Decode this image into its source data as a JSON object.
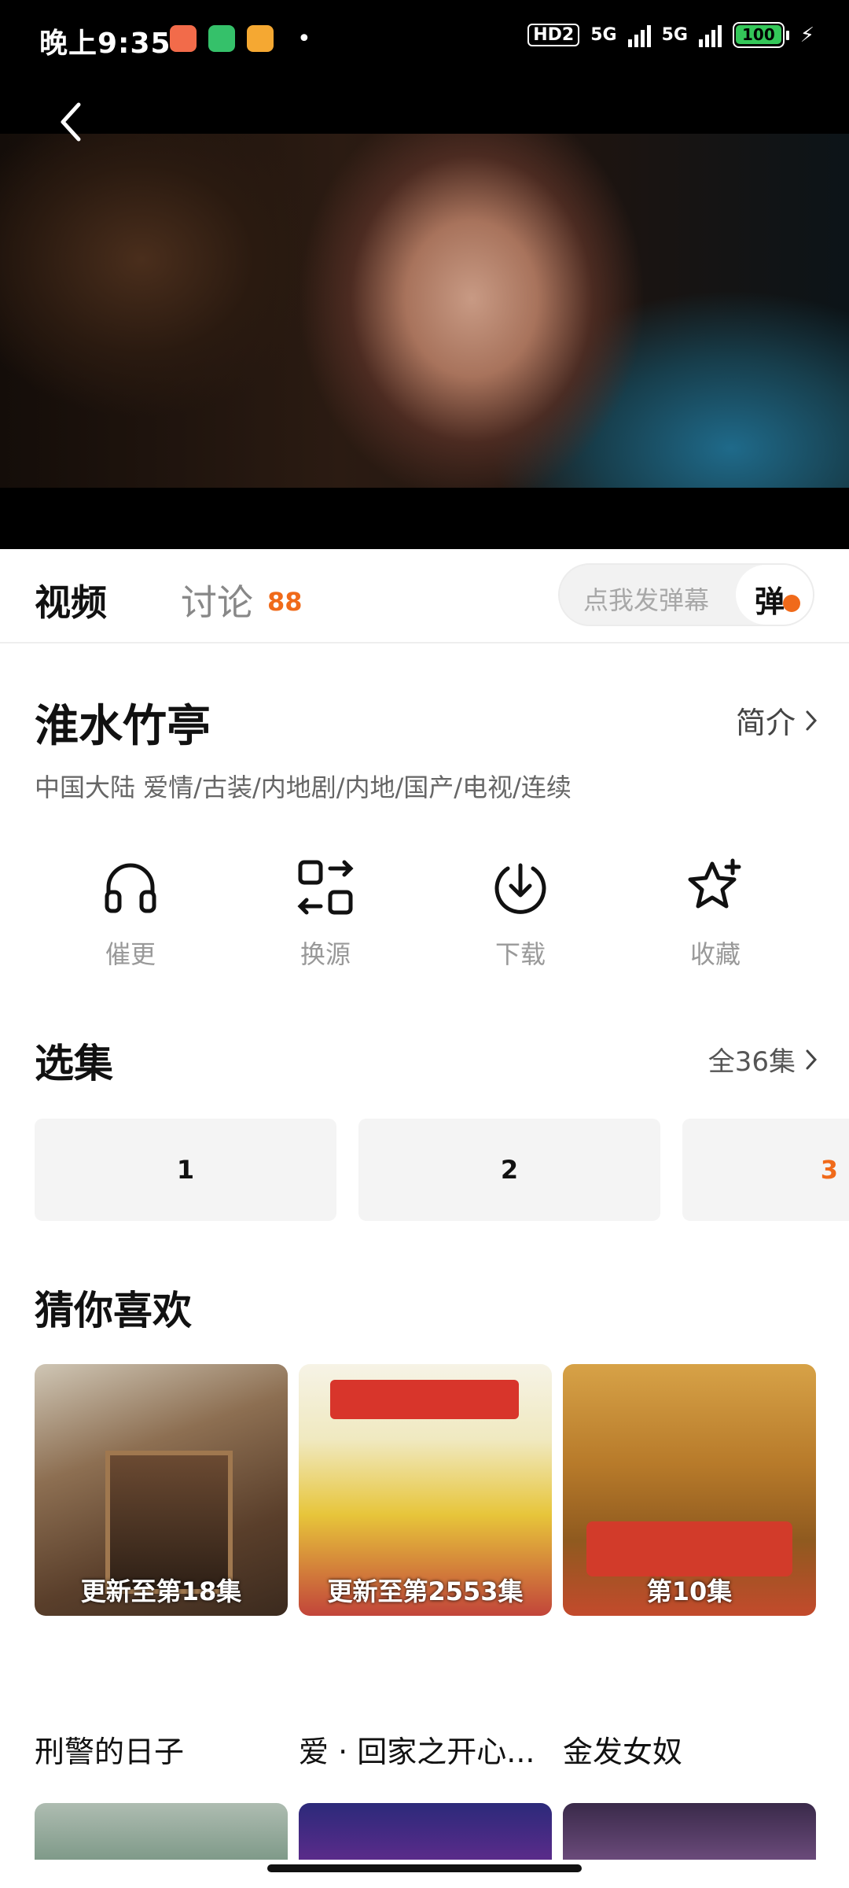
{
  "status_bar": {
    "time": "晚上9:35",
    "dot": "•",
    "hd_label": "HD2",
    "network_1": "5G",
    "network_2": "5G",
    "battery": "100"
  },
  "tabs": {
    "video": "视频",
    "discussion": "讨论",
    "discussion_count": "88",
    "danmu_placeholder": "点我发弹幕",
    "danmu_button": "弹"
  },
  "show": {
    "title": "淮水竹亭",
    "intro_link": "简介",
    "meta": "中国大陆  爱情/古装/内地剧/内地/国产/电视/连续"
  },
  "actions": [
    {
      "label": "催更",
      "icon": "headphones-icon"
    },
    {
      "label": "换源",
      "icon": "switch-source-icon"
    },
    {
      "label": "下载",
      "icon": "download-icon"
    },
    {
      "label": "收藏",
      "icon": "star-add-icon"
    }
  ],
  "episodes": {
    "section_title": "选集",
    "all_label": "全36集",
    "items": [
      "1",
      "2",
      "3"
    ],
    "active_color": "#f06a1a"
  },
  "recommend": {
    "section_title": "猜你喜欢",
    "items": [
      {
        "title": "刑警的日子",
        "badge": "更新至第18集"
      },
      {
        "title": "爱 · 回家之开心...",
        "badge": "更新至第2553集"
      },
      {
        "title": "金发女奴",
        "badge": "第10集"
      }
    ]
  },
  "colors": {
    "accent": "#f06a1a"
  }
}
